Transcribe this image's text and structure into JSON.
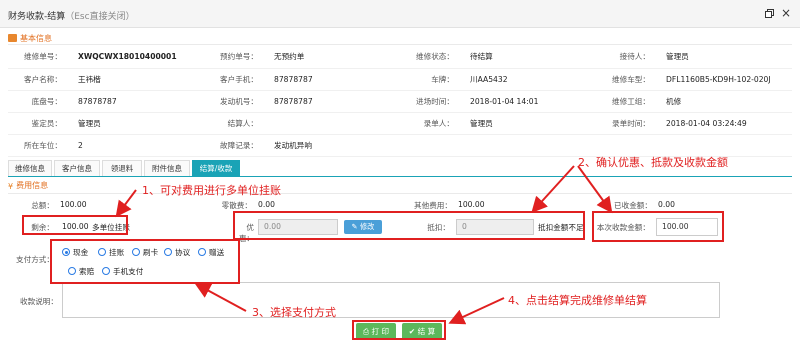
{
  "window": {
    "title": "财务收款-结算",
    "esc_hint": "（Esc直接关闭）",
    "restore_icon": "restore-icon",
    "close_icon": "close-icon"
  },
  "basic_section": {
    "title": "基本信息",
    "icon": "briefcase-icon"
  },
  "info_rows": [
    [
      {
        "k": "维修单号：",
        "v": "XWQCWX18010400001",
        "bold": true
      },
      {
        "k": "预约单号：",
        "v": "无预约单"
      },
      {
        "k": "维修状态：",
        "v": "待结算"
      },
      {
        "k": "接待人：",
        "v": "管理员"
      }
    ],
    [
      {
        "k": "客户名称：",
        "v": "王祎楷"
      },
      {
        "k": "客户手机：",
        "v": "87878787"
      },
      {
        "k": "车牌：",
        "v": "川AA5432"
      },
      {
        "k": "维修车型：",
        "v": "DFL1160B5-KD9H-102-020J"
      }
    ],
    [
      {
        "k": "底盘号：",
        "v": "87878787"
      },
      {
        "k": "发动机号：",
        "v": "87878787"
      },
      {
        "k": "进场时间：",
        "v": "2018-01-04 14:01"
      },
      {
        "k": "维修工组：",
        "v": "机修"
      }
    ],
    [
      {
        "k": "鉴定员：",
        "v": "管理员"
      },
      {
        "k": "结算人：",
        "v": ""
      },
      {
        "k": "录单人：",
        "v": "管理员"
      },
      {
        "k": "录单时间：",
        "v": "2018-01-04 03:24:49"
      }
    ],
    [
      {
        "k": "所在车位：",
        "v": "2"
      },
      {
        "k": "故障记录：",
        "v": "发动机异响"
      },
      {
        "k": "",
        "v": ""
      },
      {
        "k": "",
        "v": ""
      }
    ]
  ],
  "tabs": [
    "维修信息",
    "客户信息",
    "领退料",
    "附件信息",
    "结算/收款"
  ],
  "active_tab": 4,
  "fee_section": {
    "title": "费用信息",
    "icon": "yen-icon"
  },
  "fee": {
    "total_label": "总额：",
    "total_value": "100.00",
    "misc_label": "零散费：",
    "misc_value": "0.00",
    "other_label": "其他费用：",
    "other_value": "100.00",
    "collected_label": "已收金额：",
    "collected_value": "0.00",
    "remaining_label": "剩余：",
    "remaining_value": "100.00",
    "multi_unit_link": "多单位挂账",
    "discount_label": "优惠：",
    "discount_value": "0.00",
    "modify_button": "修改",
    "deduct_label": "抵扣：",
    "deduct_value": "0",
    "deduct_insufficient": "抵扣金额不足",
    "this_amount_label": "本次收款金额：",
    "this_amount_value": "100.00"
  },
  "payment": {
    "label": "支付方式：",
    "options": [
      "现金",
      "挂账",
      "刷卡",
      "协议",
      "赠送",
      "索赔",
      "手机支付"
    ],
    "selected": 0
  },
  "remark": {
    "label": "收款说明：",
    "value": ""
  },
  "actions": {
    "print": "打 印",
    "settle": "结 算"
  },
  "annotations": {
    "a1": "1、可对费用进行多单位挂账",
    "a2": "2、确认优惠、抵款及收款金额",
    "a3": "3、选择支付方式",
    "a4": "4、点击结算完成维修单结算"
  },
  "colors": {
    "accent": "#1aa3b6",
    "section_title": "#e26f1f",
    "annotation": "#e02020",
    "primary_button": "#5cb85c",
    "link": "#2a7be4"
  }
}
